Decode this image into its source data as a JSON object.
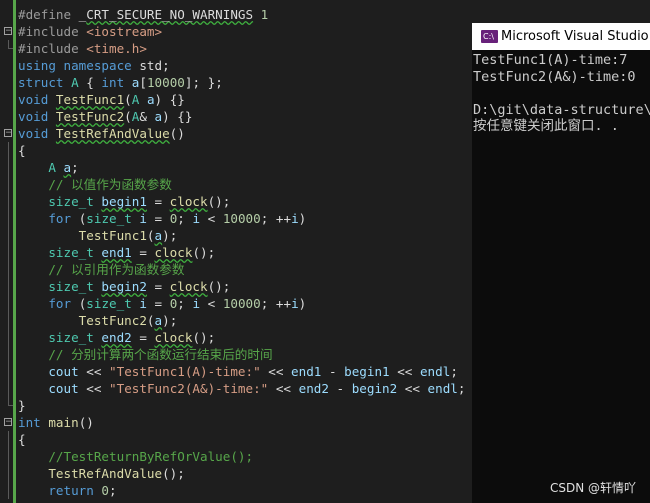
{
  "editor": {
    "lines": [
      {
        "fold": "none",
        "tokens": [
          [
            "pp",
            "#define "
          ],
          [
            "plain",
            "_"
          ],
          [
            "squig",
            "CRT_SECURE_NO_WARNINGS"
          ],
          [
            "plain",
            " "
          ],
          [
            "num",
            "1"
          ]
        ]
      },
      {
        "fold": "open",
        "tokens": [
          [
            "pp",
            "#include "
          ],
          [
            "inc",
            "<iostream>"
          ]
        ]
      },
      {
        "fold": "end",
        "tokens": [
          [
            "pp",
            "#include "
          ],
          [
            "inc",
            "<time.h>"
          ]
        ]
      },
      {
        "fold": "none",
        "tokens": [
          [
            "kw",
            "using namespace "
          ],
          [
            "plain",
            "std;"
          ]
        ]
      },
      {
        "fold": "none",
        "tokens": [
          [
            "kw",
            "struct "
          ],
          [
            "type",
            "A "
          ],
          [
            "plain",
            "{ "
          ],
          [
            "kw",
            "int "
          ],
          [
            "var",
            "a"
          ],
          [
            "plain",
            "["
          ],
          [
            "num",
            "10000"
          ],
          [
            "plain",
            "]; };"
          ]
        ]
      },
      {
        "fold": "none",
        "tokens": [
          [
            "kw",
            "void "
          ],
          [
            "fnsq",
            "TestFunc1"
          ],
          [
            "plain",
            "("
          ],
          [
            "type",
            "A "
          ],
          [
            "var",
            "a"
          ],
          [
            "plain",
            ") {}"
          ]
        ]
      },
      {
        "fold": "none",
        "tokens": [
          [
            "kw",
            "void "
          ],
          [
            "fnsq",
            "TestFunc2"
          ],
          [
            "plain",
            "("
          ],
          [
            "type",
            "A"
          ],
          [
            "plain",
            "& "
          ],
          [
            "var",
            "a"
          ],
          [
            "plain",
            ") {}"
          ]
        ]
      },
      {
        "fold": "open",
        "tokens": [
          [
            "kw",
            "void "
          ],
          [
            "fnsq",
            "TestRefAndValue"
          ],
          [
            "plain",
            "()"
          ]
        ]
      },
      {
        "fold": "line",
        "tokens": [
          [
            "plain",
            "{"
          ]
        ]
      },
      {
        "fold": "line",
        "tokens": [
          [
            "plain",
            "    "
          ],
          [
            "type",
            "A "
          ],
          [
            "varsq",
            "a"
          ],
          [
            "plain",
            ";"
          ]
        ]
      },
      {
        "fold": "line",
        "tokens": [
          [
            "plain",
            "    "
          ],
          [
            "com",
            "// 以值作为函数参数"
          ]
        ]
      },
      {
        "fold": "line",
        "tokens": [
          [
            "plain",
            "    "
          ],
          [
            "type",
            "size_t "
          ],
          [
            "varsq",
            "begin1"
          ],
          [
            "plain",
            " = "
          ],
          [
            "fnsq",
            "clock"
          ],
          [
            "plain",
            "();"
          ]
        ]
      },
      {
        "fold": "line",
        "tokens": [
          [
            "plain",
            "    "
          ],
          [
            "kw",
            "for "
          ],
          [
            "plain",
            "("
          ],
          [
            "type",
            "size_t "
          ],
          [
            "var",
            "i"
          ],
          [
            "plain",
            " = "
          ],
          [
            "num",
            "0"
          ],
          [
            "plain",
            "; "
          ],
          [
            "var",
            "i"
          ],
          [
            "plain",
            " < "
          ],
          [
            "num",
            "10000"
          ],
          [
            "plain",
            "; ++"
          ],
          [
            "var",
            "i"
          ],
          [
            "plain",
            ")"
          ]
        ]
      },
      {
        "fold": "line",
        "tokens": [
          [
            "plain",
            "        "
          ],
          [
            "fn",
            "TestFunc1"
          ],
          [
            "plain",
            "("
          ],
          [
            "varsq",
            "a"
          ],
          [
            "plain",
            ");"
          ]
        ]
      },
      {
        "fold": "line",
        "tokens": [
          [
            "plain",
            "    "
          ],
          [
            "type",
            "size_t "
          ],
          [
            "varsq",
            "end1"
          ],
          [
            "plain",
            " = "
          ],
          [
            "fnsq",
            "clock"
          ],
          [
            "plain",
            "();"
          ]
        ]
      },
      {
        "fold": "line",
        "tokens": [
          [
            "plain",
            "    "
          ],
          [
            "com",
            "// 以引用作为函数参数"
          ]
        ]
      },
      {
        "fold": "line",
        "tokens": [
          [
            "plain",
            "    "
          ],
          [
            "type",
            "size_t "
          ],
          [
            "varsq",
            "begin2"
          ],
          [
            "plain",
            " = "
          ],
          [
            "fnsq",
            "clock"
          ],
          [
            "plain",
            "();"
          ]
        ]
      },
      {
        "fold": "line",
        "tokens": [
          [
            "plain",
            "    "
          ],
          [
            "kw",
            "for "
          ],
          [
            "plain",
            "("
          ],
          [
            "type",
            "size_t "
          ],
          [
            "var",
            "i"
          ],
          [
            "plain",
            " = "
          ],
          [
            "num",
            "0"
          ],
          [
            "plain",
            "; "
          ],
          [
            "var",
            "i"
          ],
          [
            "plain",
            " < "
          ],
          [
            "num",
            "10000"
          ],
          [
            "plain",
            "; ++"
          ],
          [
            "var",
            "i"
          ],
          [
            "plain",
            ")"
          ]
        ]
      },
      {
        "fold": "line",
        "tokens": [
          [
            "plain",
            "        "
          ],
          [
            "fn",
            "TestFunc2"
          ],
          [
            "plain",
            "("
          ],
          [
            "varsq",
            "a"
          ],
          [
            "plain",
            ");"
          ]
        ]
      },
      {
        "fold": "line",
        "tokens": [
          [
            "plain",
            "    "
          ],
          [
            "type",
            "size_t "
          ],
          [
            "varsq",
            "end2"
          ],
          [
            "plain",
            " = "
          ],
          [
            "fnsq",
            "clock"
          ],
          [
            "plain",
            "();"
          ]
        ]
      },
      {
        "fold": "line",
        "tokens": [
          [
            "plain",
            "    "
          ],
          [
            "com",
            "// 分别计算两个函数运行结束后的时间"
          ]
        ]
      },
      {
        "fold": "line",
        "tokens": [
          [
            "plain",
            "    "
          ],
          [
            "var",
            "cout"
          ],
          [
            "plain",
            " << "
          ],
          [
            "str",
            "\"TestFunc1(A)-time:\""
          ],
          [
            "plain",
            " << "
          ],
          [
            "var",
            "end1"
          ],
          [
            "plain",
            " - "
          ],
          [
            "var",
            "begin1"
          ],
          [
            "plain",
            " << "
          ],
          [
            "var",
            "endl"
          ],
          [
            "plain",
            ";"
          ]
        ]
      },
      {
        "fold": "line",
        "tokens": [
          [
            "plain",
            "    "
          ],
          [
            "var",
            "cout"
          ],
          [
            "plain",
            " << "
          ],
          [
            "str",
            "\"TestFunc2(A&)-time:\""
          ],
          [
            "plain",
            " << "
          ],
          [
            "var",
            "end2"
          ],
          [
            "plain",
            " - "
          ],
          [
            "var",
            "begin2"
          ],
          [
            "plain",
            " << "
          ],
          [
            "var",
            "endl"
          ],
          [
            "plain",
            ";"
          ]
        ]
      },
      {
        "fold": "end",
        "tokens": [
          [
            "plain",
            "}"
          ]
        ]
      },
      {
        "fold": "open",
        "tokens": [
          [
            "kw",
            "int "
          ],
          [
            "fn",
            "main"
          ],
          [
            "plain",
            "()"
          ]
        ]
      },
      {
        "fold": "line",
        "tokens": [
          [
            "plain",
            "{"
          ]
        ]
      },
      {
        "fold": "line",
        "tokens": [
          [
            "plain",
            "    "
          ],
          [
            "com",
            "//TestReturnByRefOrValue();"
          ]
        ]
      },
      {
        "fold": "line",
        "tokens": [
          [
            "plain",
            "    "
          ],
          [
            "fn",
            "TestRefAndValue"
          ],
          [
            "plain",
            "();"
          ]
        ]
      },
      {
        "fold": "line",
        "tokens": [
          [
            "plain",
            "    "
          ],
          [
            "kw",
            "return "
          ],
          [
            "num",
            "0"
          ],
          [
            "plain",
            ";"
          ]
        ]
      }
    ]
  },
  "console": {
    "window_title": "Microsoft Visual Studio 调",
    "icon_label": "C:\\",
    "output_lines": [
      "TestFunc1(A)-time:7",
      "TestFunc2(A&)-time:0",
      "",
      "D:\\git\\data-structure\\",
      "按任意键关闭此窗口. ."
    ]
  },
  "watermark": "CSDN @轩情吖",
  "colors": {
    "background": "#1e1e1e",
    "keyword": "#569cd6",
    "type": "#4ec9b0",
    "function": "#dcdcaa",
    "variable": "#9cdcfe",
    "number": "#b5cea8",
    "string": "#d69d85",
    "comment": "#57a64a",
    "console_bg": "#0c0c0c"
  }
}
